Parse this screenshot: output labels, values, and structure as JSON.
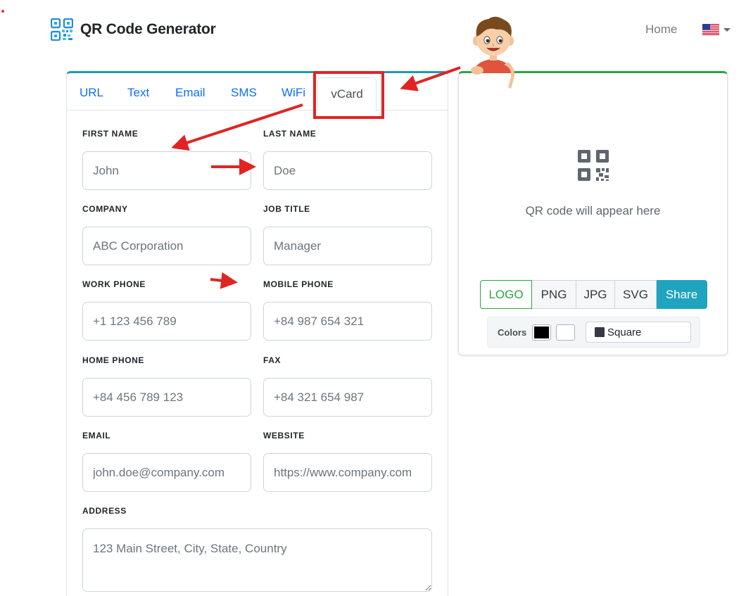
{
  "app": {
    "title": "QR Code Generator",
    "logo_icon": "qr-code-logo-icon"
  },
  "nav": {
    "home_label": "Home",
    "language_flag": "us-flag-icon"
  },
  "tabs": [
    {
      "label": "URL",
      "active": false
    },
    {
      "label": "Text",
      "active": false
    },
    {
      "label": "Email",
      "active": false
    },
    {
      "label": "SMS",
      "active": false
    },
    {
      "label": "WiFi",
      "active": false
    },
    {
      "label": "vCard",
      "active": true
    }
  ],
  "vcard": {
    "first_name": {
      "label": "FIRST NAME",
      "placeholder": "John",
      "value": ""
    },
    "last_name": {
      "label": "LAST NAME",
      "placeholder": "Doe",
      "value": ""
    },
    "company": {
      "label": "COMPANY",
      "placeholder": "ABC Corporation",
      "value": ""
    },
    "job_title": {
      "label": "JOB TITLE",
      "placeholder": "Manager",
      "value": ""
    },
    "work_phone": {
      "label": "WORK PHONE",
      "placeholder": "+1 123 456 789",
      "value": ""
    },
    "mobile_phone": {
      "label": "MOBILE PHONE",
      "placeholder": "+84 987 654 321",
      "value": ""
    },
    "home_phone": {
      "label": "HOME PHONE",
      "placeholder": "+84 456 789 123",
      "value": ""
    },
    "fax": {
      "label": "FAX",
      "placeholder": "+84 321 654 987",
      "value": ""
    },
    "email": {
      "label": "EMAIL",
      "placeholder": "john.doe@company.com",
      "value": ""
    },
    "website": {
      "label": "WEBSITE",
      "placeholder": "https://www.company.com",
      "value": ""
    },
    "address": {
      "label": "ADDRESS",
      "placeholder": "123 Main Street, City, State, Country",
      "value": ""
    }
  },
  "preview": {
    "placeholder_text": "QR code will appear here",
    "placeholder_icon": "qr-code-icon",
    "buttons": {
      "logo": "LOGO",
      "png": "PNG",
      "jpg": "JPG",
      "svg": "SVG",
      "share": "Share"
    },
    "colors_label": "Colors",
    "foreground_color": "#000000",
    "background_color": "#ffffff",
    "shape_value": "Square"
  },
  "colors": {
    "primary_link": "#0d6efd",
    "form_card_accent": "#1b9bb6",
    "preview_card_accent": "#28a745",
    "share_button": "#1ea4bf",
    "annotation_red": "#e02424"
  },
  "annotations": {
    "mascot": "cartoon-boy-pointing-mascot"
  }
}
